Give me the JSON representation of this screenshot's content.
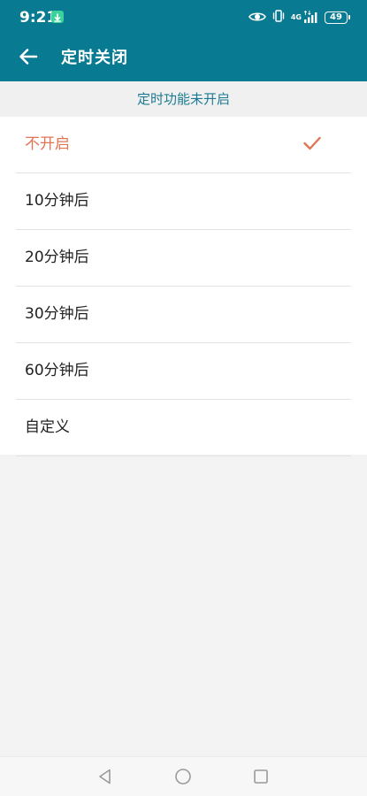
{
  "status_bar": {
    "time": "9:21",
    "network": "4G",
    "battery": "49",
    "icons": [
      "download-badge-icon",
      "eye-icon",
      "vibrate-icon",
      "signal-icon",
      "battery-icon"
    ]
  },
  "app_bar": {
    "title": "定时关闭",
    "back_icon": "back-arrow-icon"
  },
  "notice": {
    "text": "定时功能未开启"
  },
  "options": [
    {
      "label": "不开启",
      "selected": true
    },
    {
      "label": "10分钟后",
      "selected": false
    },
    {
      "label": "20分钟后",
      "selected": false
    },
    {
      "label": "30分钟后",
      "selected": false
    },
    {
      "label": "60分钟后",
      "selected": false
    },
    {
      "label": "自定义",
      "selected": false
    }
  ],
  "nav_bar": {
    "icons": [
      "nav-back-icon",
      "nav-home-icon",
      "nav-recents-icon"
    ]
  },
  "colors": {
    "primary": "#087a91",
    "accent": "#e07555",
    "download_badge": "#3ad39b",
    "background": "#f3f3f3"
  }
}
